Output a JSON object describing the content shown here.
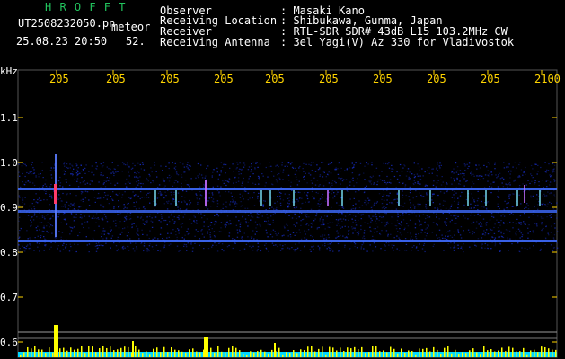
{
  "header": {
    "brand": "H R O F F T",
    "filename": "UT2508232050.pn",
    "mode": "meteor",
    "datetime": "25.08.23 20:50",
    "count": "52.",
    "fields": [
      {
        "label": "Observer",
        "value": ": Masaki Kano"
      },
      {
        "label": "Receiving Location",
        "value": ": Shibukawa, Gunma, Japan"
      },
      {
        "label": "Receiver",
        "value": ": RTL-SDR SDR# 43dB L15 103.2MHz CW"
      },
      {
        "label": "Receiving Antenna",
        "value": ": 3el Yagi(V) Az 330 for Vladivostok"
      }
    ]
  },
  "axis": {
    "y_unit": "kHz",
    "y_ticks": [
      "1.1",
      "1.0",
      "0.9",
      "0.8",
      "0.7",
      "0.6"
    ],
    "x_ticks": [
      "205",
      "205",
      "205",
      "205",
      "205",
      "205",
      "205",
      "205",
      "205",
      "2100"
    ]
  },
  "colors": {
    "background": "#000000",
    "brand": "#22c55e",
    "text": "#ffffff",
    "ticks": "#ffd400",
    "spectrum": "#1a32d8",
    "bars": "#ffff00",
    "baseline": "#00d8ff"
  }
}
